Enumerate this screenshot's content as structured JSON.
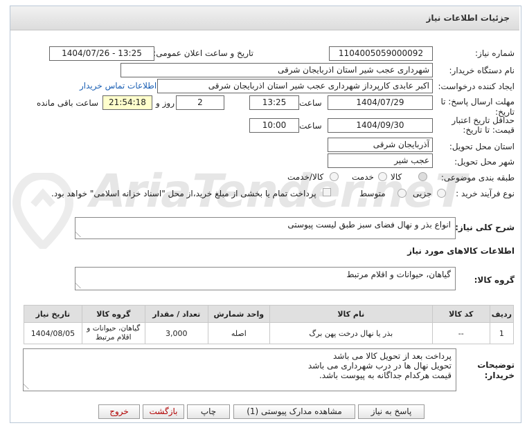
{
  "header": {
    "title": "جزئیات اطلاعات نیاز"
  },
  "watermark": {
    "text": "AriaTender.neT"
  },
  "fields": {
    "need_number_label": "شماره نیاز:",
    "need_number": "1104005059000092",
    "announce_label": "تاریخ و ساعت اعلان عمومی:",
    "announce_value": "1404/07/26 - 13:25",
    "buyer_org_label": "نام دستگاه خریدار:",
    "buyer_org": "شهرداری عجب شیر استان اذربایجان شرقی",
    "requester_label": "ایجاد کننده درخواست:",
    "requester": "اکبر عابدی کارپرداز شهرداری عجب شیر استان اذربایجان شرقی",
    "contact_link": "اطلاعات تماس خریدار",
    "send_deadline_label_1": "مهلت ارسال پاسخ: تا",
    "send_deadline_label_2": "تاریخ:",
    "send_date": "1404/07/29",
    "time_label": "ساعت",
    "send_time": "13:25",
    "days": "2",
    "days_label": "روز و",
    "remaining": "21:54:18",
    "remaining_label": "ساعت باقی مانده",
    "validity_label_1": "حداقل تاریخ اعتبار",
    "validity_label_2": "قیمت: تا تاریخ:",
    "validity_date": "1404/09/30",
    "validity_time": "10:00",
    "province_label": "استان محل تحویل:",
    "province": "آذربایجان شرقی",
    "city_label": "شهر محل تحویل:",
    "city": "عجب شیر",
    "category_label": "طبقه بندی موضوعی:",
    "category_options": [
      "کالا",
      "خدمت",
      "کالا/خدمت"
    ],
    "category_selected": "کالا",
    "process_label": "نوع فرآیند خرید :",
    "process_options": [
      "جزیی",
      "متوسط"
    ],
    "payment_note": "پرداخت تمام یا بخشی از مبلغ خرید،از محل \"اسناد خزانه اسلامی\" خواهد بود."
  },
  "description": {
    "label": "شرح کلی نیاز:",
    "value": "انواع بذر و نهال فضای سبز طبق لیست پیوستی"
  },
  "goods_section": {
    "title": "اطلاعات کالاهای مورد نیاز"
  },
  "goods_group": {
    "label": "گروه کالا:",
    "value": "گیاهان، حیوانات و اقلام مرتبط"
  },
  "table": {
    "columns": [
      "ردیف",
      "کد کالا",
      "نام کالا",
      "واحد شمارش",
      "تعداد / مقدار",
      "گروه کالا",
      "تاریخ نیاز"
    ],
    "rows": [
      [
        "1",
        "--",
        "بذر یا نهال درخت پهن برگ",
        "اصله",
        "3,000",
        "گیاهان، حیوانات و اقلام مرتبط",
        "1404/08/05"
      ]
    ]
  },
  "buyer_notes": {
    "label_1": "توضیحات",
    "label_2": "خریدار:",
    "lines": [
      "پرداخت بعد از تحویل کالا می باشد",
      "تحویل نهال ها در درب شهرداری می باشد",
      "قیمت هرکدام  جداگانه به پیوست باشد."
    ]
  },
  "buttons": {
    "reply": "پاسخ به نیاز",
    "attachments": "مشاهده مدارک پیوستی (1)",
    "print": "چاپ",
    "back": "بازگشت",
    "exit": "خروج"
  }
}
